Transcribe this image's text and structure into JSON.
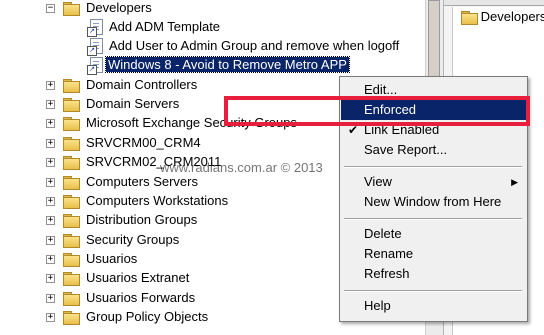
{
  "tree": {
    "developers": "Developers",
    "gpo_links": [
      "Add ADM Template",
      "Add User to Admin Group and remove when logoff",
      "Windows 8 - Avoid to Remove Metro APP"
    ],
    "ous": [
      "Domain Controllers",
      "Domain Servers",
      "Microsoft Exchange Security Groups",
      "SRVCRM00_CRM4",
      "SRVCRM02_CRM2011",
      "Computers Servers",
      "Computers Workstations",
      "Distribution Groups",
      "Security Groups",
      "Usuarios",
      "Usuarios Extranet",
      "Usuarios Forwards",
      "Group Policy Objects"
    ]
  },
  "right_panel": {
    "item": "Developers"
  },
  "context_menu": {
    "items": [
      {
        "label": "Edit...",
        "highlighted": false,
        "checked": false
      },
      {
        "label": "Enforced",
        "highlighted": true,
        "checked": false
      },
      {
        "label": "Link Enabled",
        "highlighted": false,
        "checked": true
      },
      {
        "label": "Save Report...",
        "highlighted": false,
        "checked": false
      },
      {
        "label": "View",
        "highlighted": false,
        "checked": false,
        "submenu": true
      },
      {
        "label": "New Window from Here",
        "highlighted": false,
        "checked": false
      },
      {
        "label": "Delete",
        "highlighted": false,
        "checked": false
      },
      {
        "label": "Rename",
        "highlighted": false,
        "checked": false
      },
      {
        "label": "Refresh",
        "highlighted": false,
        "checked": false
      },
      {
        "label": "Help",
        "highlighted": false,
        "checked": false
      }
    ]
  },
  "watermark": "www.radians.com.ar © 2013",
  "colors": {
    "selection": "#0a246a",
    "highlight_box": "#e81f3c",
    "menu_bg": "#f0f0f0"
  }
}
